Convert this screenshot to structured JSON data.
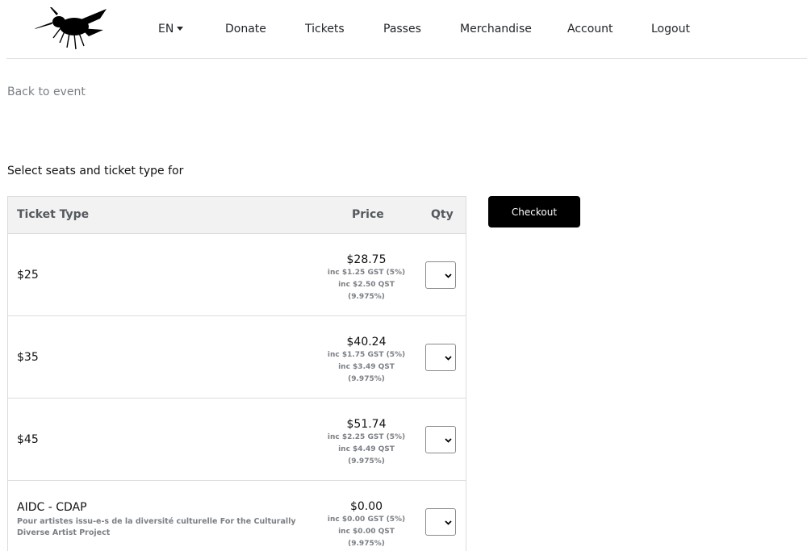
{
  "nav": {
    "language": "EN",
    "items": [
      "Donate",
      "Tickets",
      "Passes",
      "Merchandise",
      "Account",
      "Logout"
    ]
  },
  "back_link": "Back to event",
  "section_title": "Select seats and ticket type for",
  "checkout_label": "Checkout",
  "table": {
    "headers": {
      "type": "Ticket Type",
      "price": "Price",
      "qty": "Qty"
    },
    "rows": [
      {
        "name": "$25",
        "description": "",
        "price": "$28.75",
        "tax1": "inc $1.25 GST (5%)",
        "tax2a": "inc $2.50 QST",
        "tax2b": "(9.975%)"
      },
      {
        "name": "$35",
        "description": "",
        "price": "$40.24",
        "tax1": "inc $1.75 GST (5%)",
        "tax2a": "inc $3.49 QST",
        "tax2b": "(9.975%)"
      },
      {
        "name": "$45",
        "description": "",
        "price": "$51.74",
        "tax1": "inc $2.25 GST (5%)",
        "tax2a": "inc $4.49 QST",
        "tax2b": "(9.975%)"
      },
      {
        "name": "AIDC - CDAP",
        "description": "Pour artistes issu-e-s de la diversité culturelle For the Culturally Diverse Artist Project",
        "price": "$0.00",
        "tax1": "inc $0.00 GST (5%)",
        "tax2a": "inc $0.00 QST",
        "tax2b": "(9.975%)"
      }
    ]
  }
}
